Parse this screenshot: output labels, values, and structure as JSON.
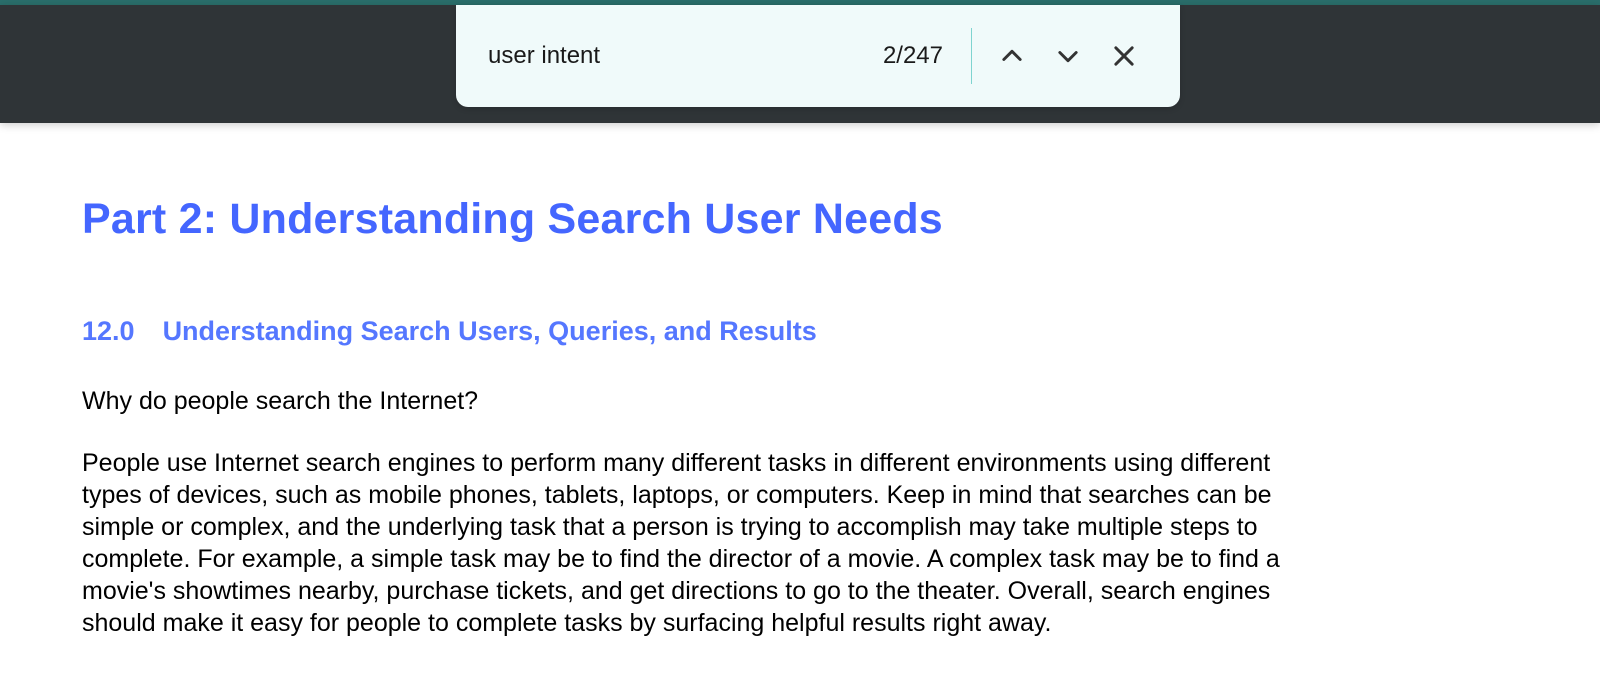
{
  "findbar": {
    "query": "user intent",
    "count": "2/247"
  },
  "document": {
    "part_title": "Part 2: Understanding Search User Needs",
    "section_number": "12.0",
    "section_title": "Understanding Search Users, Queries, and Results",
    "para1": "Why do people search the Internet?",
    "para2": "People use Internet search engines to perform many different tasks in different environments using different types of devices, such as mobile phones, tablets, laptops, or computers.  Keep in mind that searches can be simple or complex, and the underlying task that a person is trying to accomplish may take multiple steps to complete.  For example, a simple task may be to find the director of a movie.  A complex task may be to find a movie's showtimes nearby, purchase tickets, and get directions to go to the theater.  Overall, search engines should make it easy for people to complete tasks by surfacing helpful results right away."
  }
}
